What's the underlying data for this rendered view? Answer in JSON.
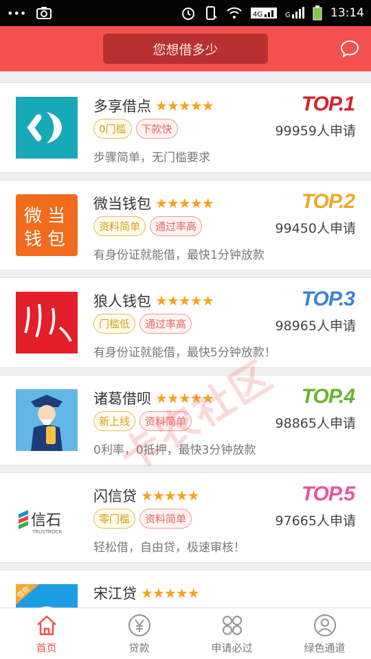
{
  "status_bar": {
    "dots": "•••",
    "time": "13:14",
    "network": "4G"
  },
  "header": {
    "ask_button": "您想借多少"
  },
  "cards": [
    {
      "name": "多享借点",
      "stars": "★★★★★",
      "tags": [
        {
          "text": "0门槛",
          "color": "yellow"
        },
        {
          "text": "下款快",
          "color": "red"
        }
      ],
      "desc": "步骤简单，无门槛要求",
      "rank": "TOP.1",
      "rank_color": "#d9202a",
      "count": "99959人申请",
      "logo_icon": "duoxiang-logo"
    },
    {
      "name": "微当钱包",
      "stars": "★★★★★",
      "tags": [
        {
          "text": "资料简单",
          "color": "yellow"
        },
        {
          "text": "通过率高",
          "color": "red"
        }
      ],
      "desc": "有身份证就能借，最快1分钟放款",
      "rank": "TOP.2",
      "rank_color": "#f5a623",
      "count": "99450人申请",
      "logo_icon": "weidang-logo",
      "logo_text": "微当钱包"
    },
    {
      "name": "狼人钱包",
      "stars": "★★★★★",
      "tags": [
        {
          "text": "门槛低",
          "color": "yellow"
        },
        {
          "text": "通过率高",
          "color": "red"
        }
      ],
      "desc": "有身份证就能借，最快5分钟放款！",
      "rank": "TOP.3",
      "rank_color": "#3b82d6",
      "count": "98965人申请",
      "logo_icon": "wolf-claw-logo"
    },
    {
      "name": "诸葛借呗",
      "stars": "★★★★★",
      "tags": [
        {
          "text": "新上线",
          "color": "yellow"
        },
        {
          "text": "资料简单",
          "color": "red"
        }
      ],
      "desc": "0利率，0抵押，最快3分钟放款",
      "rank": "TOP.4",
      "rank_color": "#6ab22e",
      "count": "98865人申请",
      "logo_icon": "zhuge-logo"
    },
    {
      "name": "闪信贷",
      "stars": "★★★★★",
      "tags": [
        {
          "text": "零门槛",
          "color": "yellow"
        },
        {
          "text": "资料简单",
          "color": "red"
        }
      ],
      "desc": "轻松借，自由贷，极速审核！",
      "rank": "TOP.5",
      "rank_color": "#e8559a",
      "count": "97665人申请",
      "logo_icon": "xinshi-logo",
      "logo_text": "信石",
      "logo_subtext": "TRUSTROCK"
    },
    {
      "name": "宋江贷",
      "stars": "★★★★★",
      "tags": [],
      "desc": "",
      "rank": "",
      "rank_color": "#d9202a",
      "count": "",
      "logo_icon": "songjiang-logo",
      "logo_text": "借款"
    }
  ],
  "watermark": "卡农社区",
  "bottom_nav": [
    {
      "label": "首页",
      "icon": "home-icon",
      "active": true
    },
    {
      "label": "贷款",
      "icon": "yen-icon",
      "active": false
    },
    {
      "label": "申请必过",
      "icon": "grid-icon",
      "active": false
    },
    {
      "label": "绿色通道",
      "icon": "user-icon",
      "active": false
    }
  ],
  "colors": {
    "brand": "#f4504e",
    "header_button": "#b8302f",
    "star": "#f6a21f"
  }
}
